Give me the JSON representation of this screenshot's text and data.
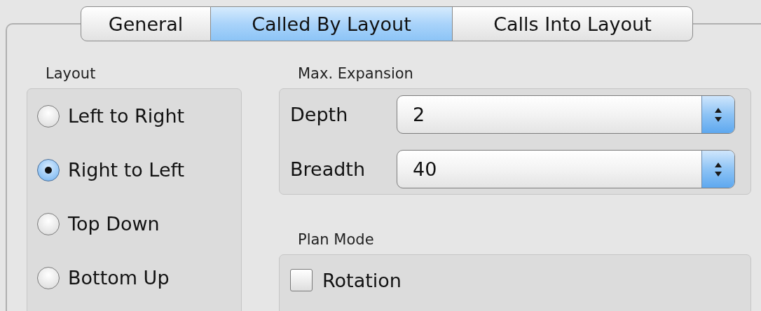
{
  "tabs": [
    {
      "label": "General",
      "selected": false
    },
    {
      "label": "Called By Layout",
      "selected": true
    },
    {
      "label": "Calls Into Layout",
      "selected": false
    }
  ],
  "layout": {
    "title": "Layout",
    "options": [
      {
        "label": "Left to Right",
        "selected": false
      },
      {
        "label": "Right to Left",
        "selected": true
      },
      {
        "label": "Top Down",
        "selected": false
      },
      {
        "label": "Bottom Up",
        "selected": false
      }
    ]
  },
  "max_expansion": {
    "title": "Max. Expansion",
    "fields": [
      {
        "label": "Depth",
        "value": "2"
      },
      {
        "label": "Breadth",
        "value": "40"
      }
    ]
  },
  "plan_mode": {
    "title": "Plan Mode",
    "options": [
      {
        "label": "Rotation",
        "checked": false
      }
    ]
  }
}
